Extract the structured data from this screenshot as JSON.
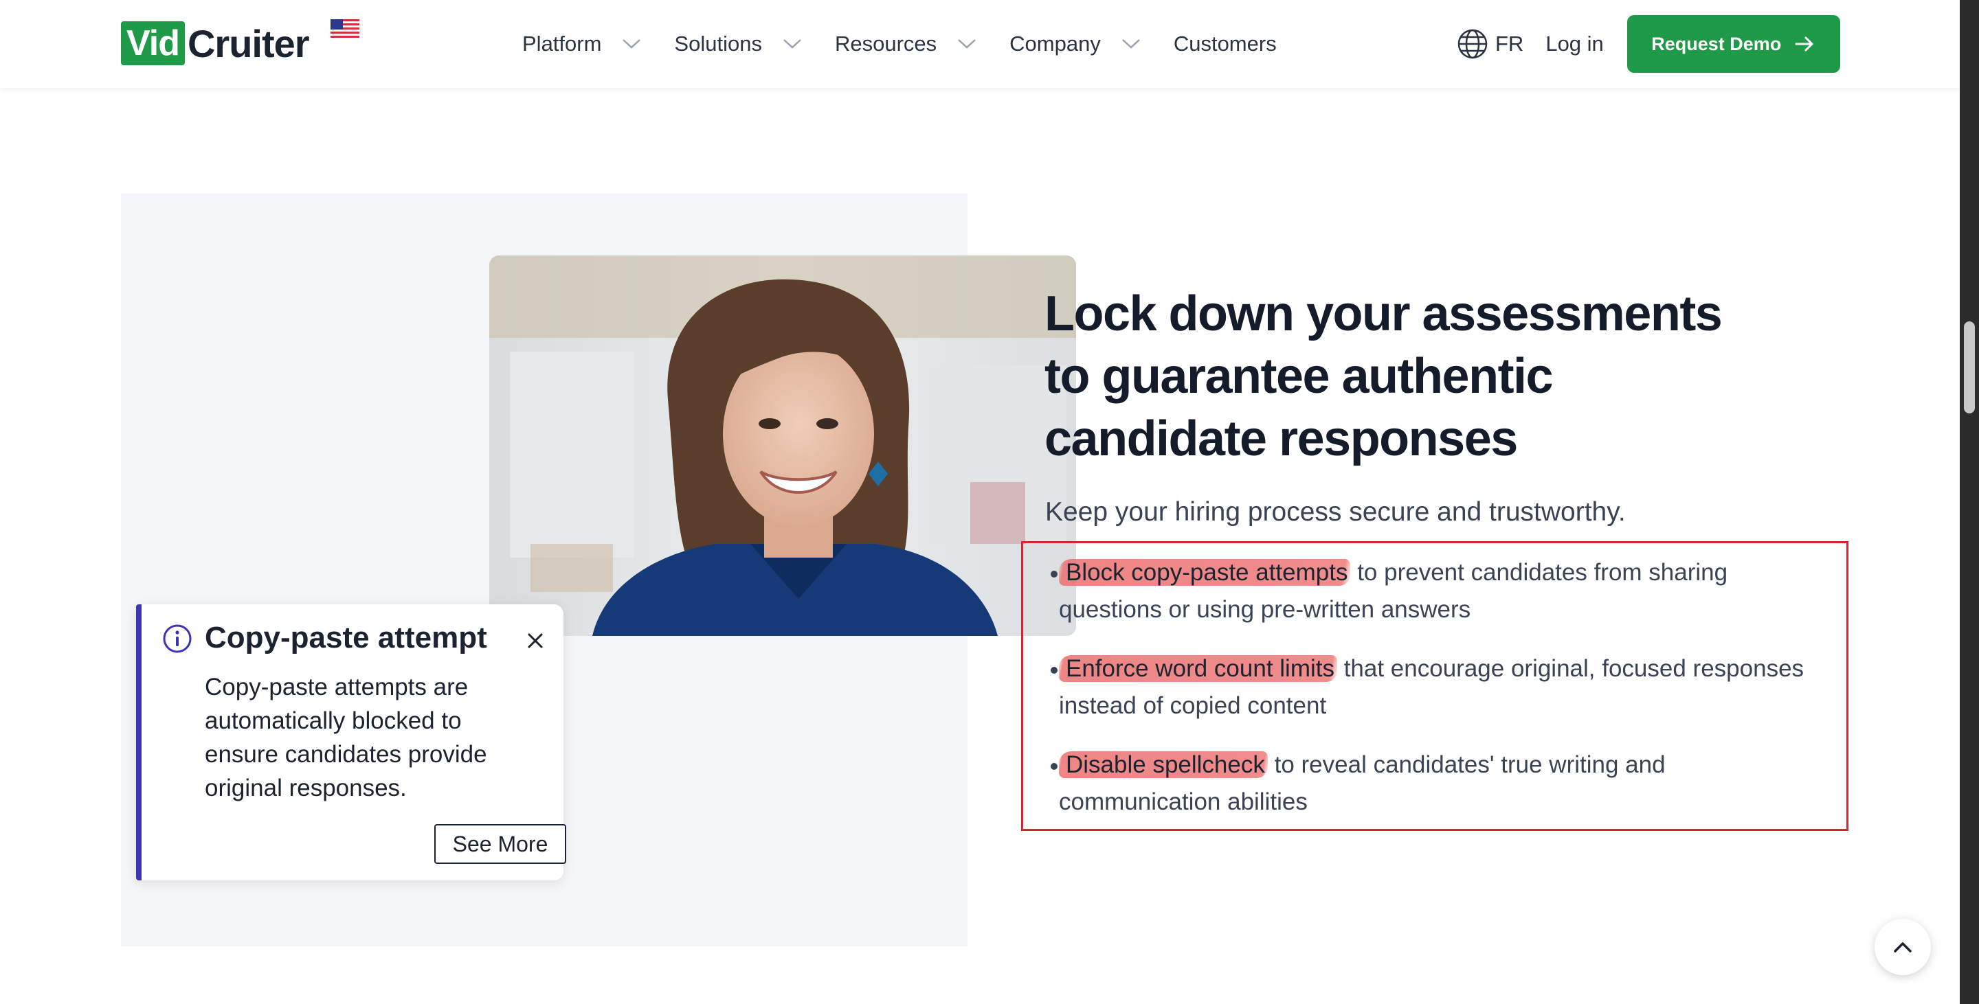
{
  "header": {
    "logo": {
      "vid": "Vid",
      "cruiter": "Cruiter",
      "flag_icon": "us-flag-icon"
    },
    "nav": [
      {
        "label": "Platform",
        "has_dropdown": true
      },
      {
        "label": "Solutions",
        "has_dropdown": true
      },
      {
        "label": "Resources",
        "has_dropdown": true
      },
      {
        "label": "Company",
        "has_dropdown": true
      },
      {
        "label": "Customers",
        "has_dropdown": false
      }
    ],
    "language": {
      "icon": "globe-icon",
      "label": "FR"
    },
    "login_label": "Log in",
    "demo_button": {
      "label": "Request Demo",
      "icon": "arrow-right-icon",
      "color": "#1f9a49"
    }
  },
  "media": {
    "photo": "smiling-candidate-photo",
    "notice": {
      "icon": "info-icon",
      "title": "Copy-paste attempt",
      "close_icon": "close-icon",
      "body": "Copy-paste attempts are automatically blocked to ensure candidates provide original responses.",
      "button_label": "See More",
      "accent_color": "#3d34b5"
    }
  },
  "content": {
    "headline": "Lock down your assessments to guarantee authentic candidate responses",
    "subhead": "Keep your hiring process secure and trustworthy.",
    "bullets": [
      {
        "highlight": "Block copy-paste attempts",
        "rest": " to prevent candidates from sharing questions or using pre-written answers"
      },
      {
        "highlight": "Enforce word count limits",
        "rest": " that encourage original, focused responses instead of copied content"
      },
      {
        "highlight": "Disable spellcheck",
        "rest": " to reveal candidates' true writing and communication abilities"
      }
    ],
    "box_color": "#d8262f",
    "highlight_color": "#ec7070"
  },
  "back_to_top": {
    "icon": "chevron-up-icon"
  }
}
